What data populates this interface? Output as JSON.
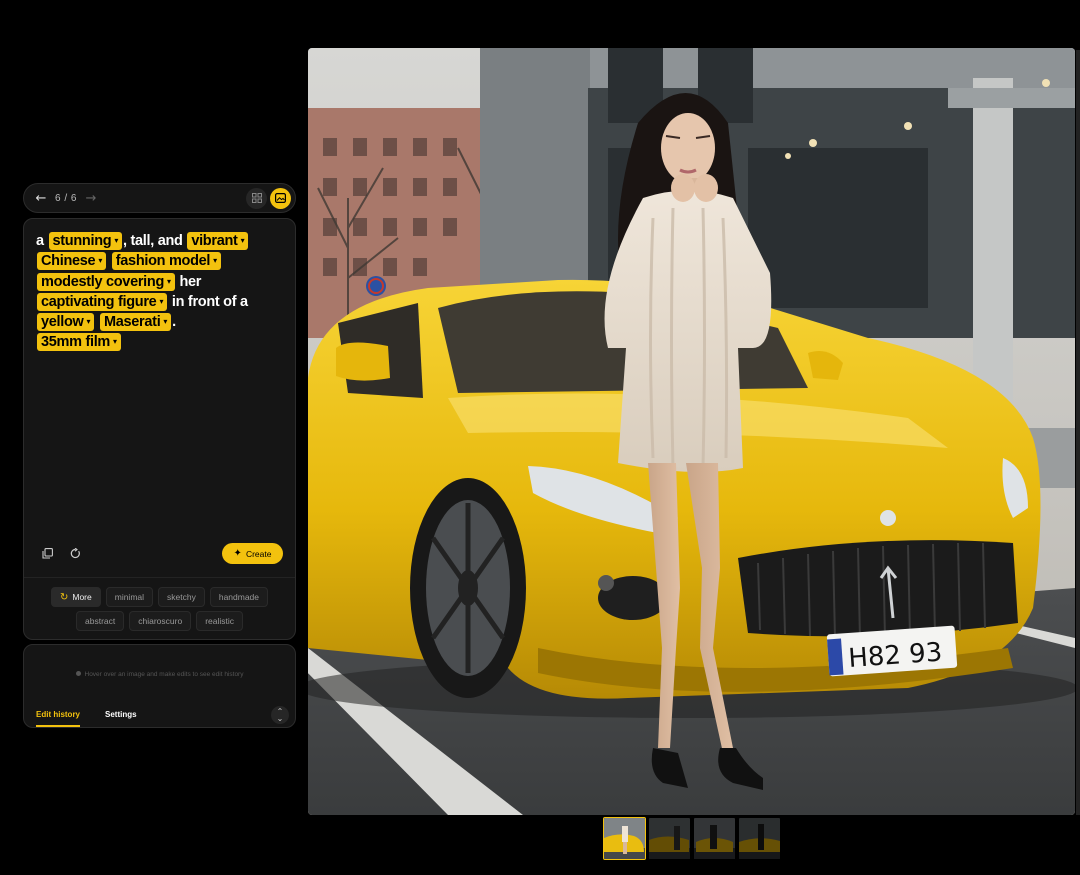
{
  "navigation": {
    "back_icon": "arrow-left-icon",
    "forward_icon": "arrow-right-icon",
    "page_counter": "6 / 6",
    "view_toggles": [
      {
        "icon": "grid-icon",
        "active": false
      },
      {
        "icon": "single-image-icon",
        "active": true
      }
    ]
  },
  "prompt": {
    "segments": [
      {
        "text": "a",
        "chip": false
      },
      {
        "text": "stunning",
        "chip": true
      },
      {
        "text": ", tall, and",
        "chip": false
      },
      {
        "text": "vibrant",
        "chip": true
      },
      {
        "text": "Chinese",
        "chip": true
      },
      {
        "text": "fashion model",
        "chip": true
      },
      {
        "text": "modestly covering",
        "chip": true
      },
      {
        "text": "her",
        "chip": false
      },
      {
        "text": "captivating figure",
        "chip": true
      },
      {
        "text": "in front of a",
        "chip": false
      },
      {
        "text": "yellow",
        "chip": true
      },
      {
        "text": "Maserati",
        "chip": true
      },
      {
        "text": ".",
        "chip": false
      },
      {
        "text": "35mm film",
        "chip": true
      }
    ],
    "tools": [
      {
        "icon": "copy-icon"
      },
      {
        "icon": "reset-icon"
      }
    ],
    "create_label": "Create",
    "create_icon": "plus-icon",
    "accent_color": "#f3c20e"
  },
  "styles": {
    "more_label": "More",
    "more_icon": "refresh-icon",
    "row1": [
      "minimal",
      "sketchy",
      "handmade"
    ],
    "row2": [
      "abstract",
      "chiaroscuro",
      "realistic"
    ]
  },
  "history": {
    "hint": "Hover over an image and make edits to see edit history",
    "tabs": [
      "Edit history",
      "Settings"
    ],
    "active_tab": "Edit history",
    "collapse_icon": "chevron-up-down-icon"
  },
  "image": {
    "plate_text": "H82 93"
  },
  "thumbnails": {
    "count": 4,
    "active_index": 0
  }
}
